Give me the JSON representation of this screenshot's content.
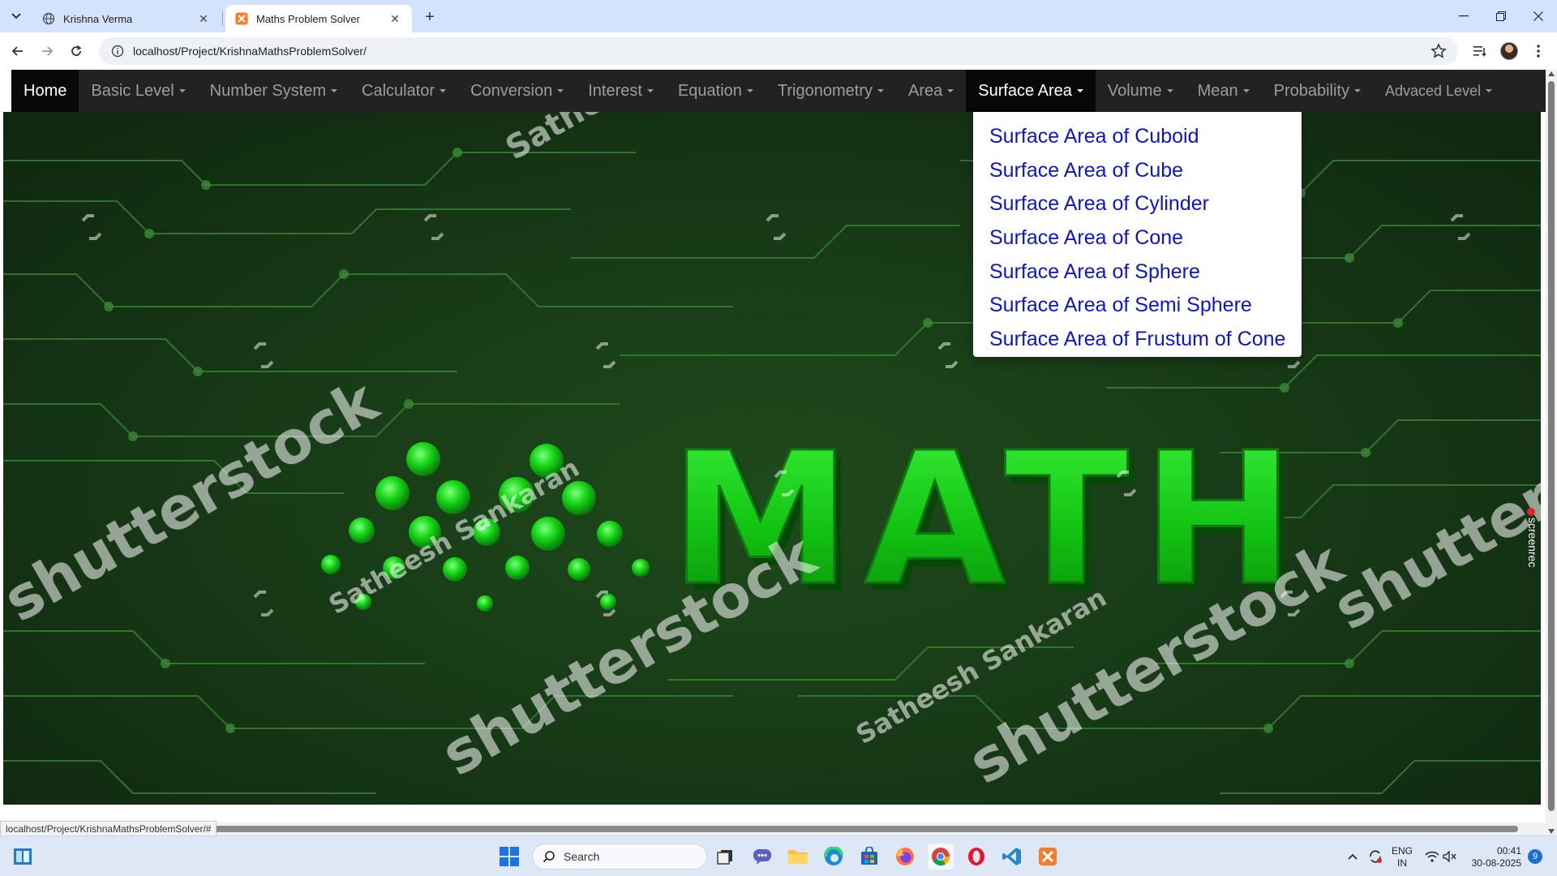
{
  "browser": {
    "tabs": [
      {
        "title": "Krishna Verma",
        "active": false,
        "favicon": "globe-icon"
      },
      {
        "title": "Maths Problem Solver",
        "active": true,
        "favicon": "xampp-icon"
      }
    ],
    "url": "localhost/Project/KrishnaMathsProblemSolver/",
    "status_url": "localhost/Project/KrishnaMathsProblemSolver/#"
  },
  "navbar": {
    "items": [
      {
        "label": "Home",
        "dropdown": false
      },
      {
        "label": "Basic Level",
        "dropdown": true
      },
      {
        "label": "Number System",
        "dropdown": true
      },
      {
        "label": "Calculator",
        "dropdown": true
      },
      {
        "label": "Conversion",
        "dropdown": true
      },
      {
        "label": "Interest",
        "dropdown": true
      },
      {
        "label": "Equation",
        "dropdown": true
      },
      {
        "label": "Trigonometry",
        "dropdown": true
      },
      {
        "label": "Area",
        "dropdown": true
      },
      {
        "label": "Surface Area",
        "dropdown": true
      },
      {
        "label": "Volume",
        "dropdown": true
      },
      {
        "label": "Mean",
        "dropdown": true
      },
      {
        "label": "Probability",
        "dropdown": true
      },
      {
        "label": "Advaced Level",
        "dropdown": true
      }
    ],
    "active_index": 9
  },
  "dropdown": {
    "items": [
      "Surface Area of Cuboid",
      "Surface Area of Cube",
      "Surface Area of Cylinder",
      "Surface Area of Cone",
      "Surface Area of Sphere",
      "Surface Area of Semi Sphere",
      "Surface Area of Frustum of Cone"
    ]
  },
  "hero": {
    "title": "MATH",
    "watermarks": [
      "shutterstock",
      "Satheesh Sankaran"
    ]
  },
  "screenrec": {
    "label": "screenrec"
  },
  "taskbar": {
    "search_placeholder": "Search",
    "lang_top": "ENG",
    "lang_bottom": "IN",
    "time": "00:41",
    "date": "30-08-2025",
    "notification_count": "9"
  },
  "colors": {
    "navbar_bg": "#222222",
    "navbar_active_bg": "#080808",
    "dropdown_link": "#0c14d6",
    "math_green": "#22d622",
    "tab_strip": "#d3e3fd"
  }
}
